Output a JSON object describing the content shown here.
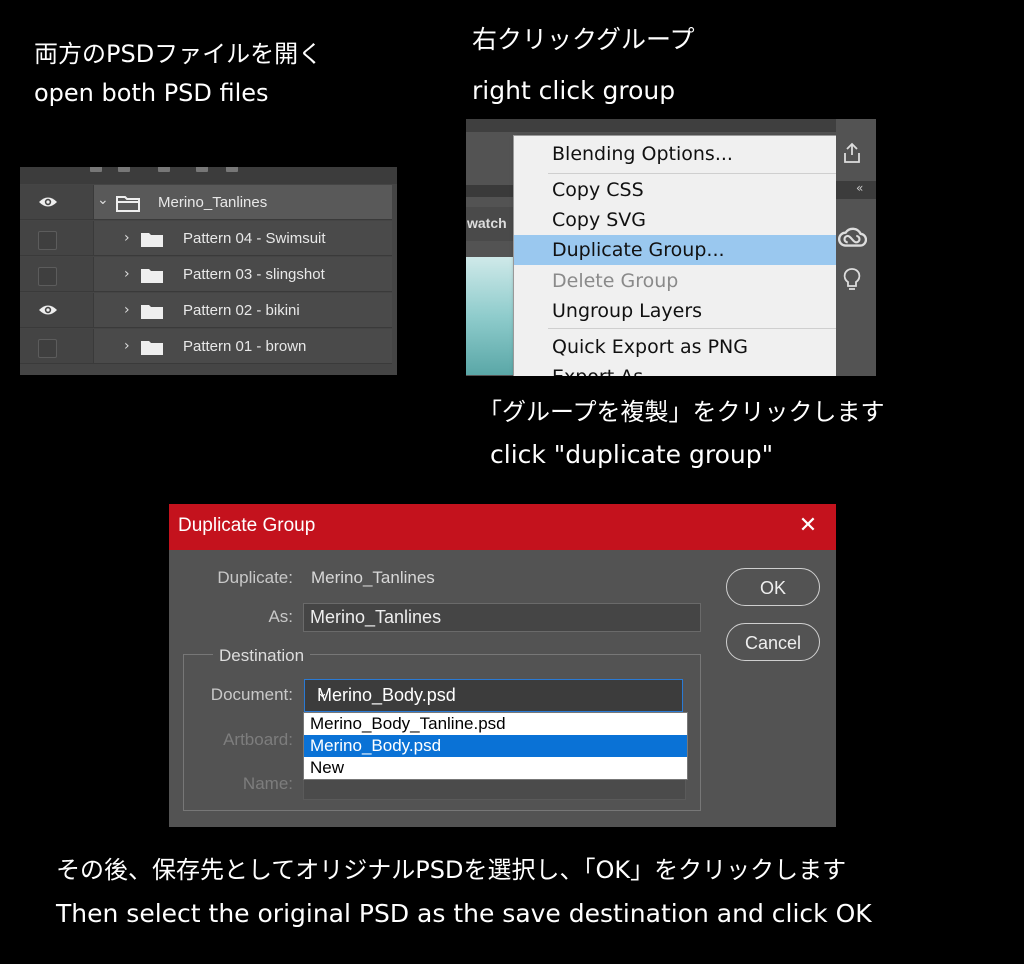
{
  "captions": {
    "step1_jp": "両方のPSDファイルを開く",
    "step1_en": "open both PSD files",
    "step2_jp": "右クリックグループ",
    "step2_en": "right click group",
    "step3_jp": "「グループを複製」をクリックします",
    "step3_en": "click \"duplicate group\"",
    "step4_jp": "その後、保存先としてオリジナルPSDを選択し、「OK」をクリックします",
    "step4_en": "Then select the original PSD as the save destination and click OK"
  },
  "layers": [
    {
      "name": "Merino_Tanlines",
      "visible": true,
      "expanded": true,
      "selected": true,
      "level": 0
    },
    {
      "name": "Pattern 04 - Swimsuit",
      "visible": false,
      "expanded": false,
      "selected": false,
      "level": 1
    },
    {
      "name": "Pattern 03 - slingshot",
      "visible": false,
      "expanded": false,
      "selected": false,
      "level": 1
    },
    {
      "name": "Pattern 02 - bikini",
      "visible": true,
      "expanded": false,
      "selected": false,
      "level": 1
    },
    {
      "name": "Pattern 01 - brown",
      "visible": false,
      "expanded": false,
      "selected": false,
      "level": 1
    }
  ],
  "context_menu": {
    "partial_tab_label": "watch",
    "items": [
      {
        "label": "Blending Options...",
        "state": "normal"
      },
      {
        "label": "Copy CSS",
        "state": "normal"
      },
      {
        "label": "Copy SVG",
        "state": "normal"
      },
      {
        "label": "Duplicate Group...",
        "state": "highlighted"
      },
      {
        "label": "Delete Group",
        "state": "disabled"
      },
      {
        "label": "Ungroup Layers",
        "state": "normal"
      },
      {
        "label": "Quick Export as PNG",
        "state": "normal"
      },
      {
        "label": "Export As...",
        "state": "normal"
      }
    ]
  },
  "dialog": {
    "title": "Duplicate Group",
    "duplicate_label": "Duplicate:",
    "duplicate_value": "Merino_Tanlines",
    "as_label": "As:",
    "as_value": "Merino_Tanlines",
    "destination_label": "Destination",
    "document_label": "Document:",
    "document_value": "Merino_Body.psd",
    "document_options": [
      "Merino_Body_Tanline.psd",
      "Merino_Body.psd",
      "New"
    ],
    "document_selected_index": 1,
    "artboard_label": "Artboard:",
    "name_label": "Name:",
    "ok_label": "OK",
    "cancel_label": "Cancel",
    "accent": "#c4121d"
  },
  "icons": {
    "eye": "eye-icon",
    "folder": "folder-icon",
    "close": "close-icon",
    "share": "share-icon",
    "creative_cloud": "creative-cloud-icon",
    "lightbulb": "lightbulb-icon"
  }
}
